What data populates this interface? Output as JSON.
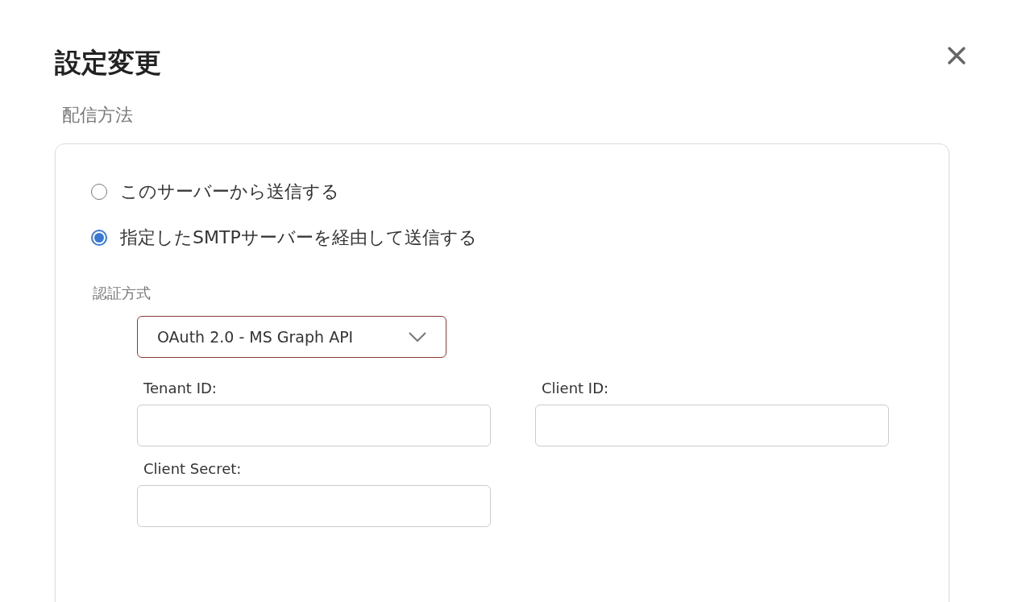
{
  "dialog": {
    "title": "設定変更"
  },
  "section_label": "配信方法",
  "delivery_options": [
    {
      "label": "このサーバーから送信する",
      "selected": false
    },
    {
      "label": "指定したSMTPサーバーを経由して送信する",
      "selected": true
    }
  ],
  "auth": {
    "label": "認証方式",
    "dropdown": {
      "value": "OAuth 2.0 - MS Graph API"
    }
  },
  "fields": [
    {
      "label": "Tenant ID:"
    },
    {
      "label": "Client ID:"
    },
    {
      "label": "Client Secret:"
    }
  ]
}
